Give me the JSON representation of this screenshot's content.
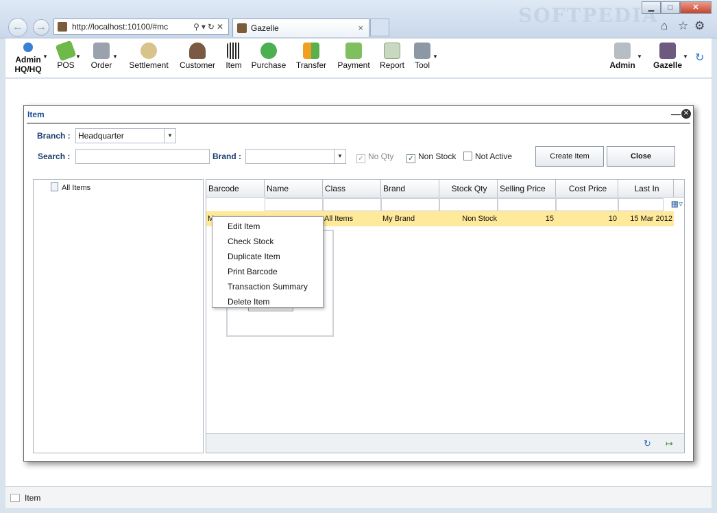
{
  "browser": {
    "address": "http://localhost:10100/#mc",
    "tab_title": "Gazelle",
    "tab_close": "×",
    "watermark": "SOFTPEDIA",
    "win_min": "▁",
    "win_max": "□",
    "win_close": "✕"
  },
  "toolbar": {
    "admin_user": "Admin HQ/HQ",
    "pos": "POS",
    "order": "Order",
    "settlement": "Settlement",
    "customer": "Customer",
    "item": "Item",
    "purchase": "Purchase",
    "transfer": "Transfer",
    "payment": "Payment",
    "report": "Report",
    "tool": "Tool",
    "admin": "Admin",
    "gazelle": "Gazelle"
  },
  "dialog": {
    "title": "Item",
    "branch_label": "Branch :",
    "branch_value": "Headquarter",
    "search_label": "Search :",
    "search_value": "",
    "brand_label": "Brand :",
    "brand_value": "",
    "no_qty": "No Qty",
    "non_stock": "Non Stock",
    "not_active": "Not Active",
    "create_item": "Create Item",
    "close": "Close"
  },
  "tree": {
    "root": "All Items"
  },
  "grid": {
    "columns": [
      "Barcode",
      "Name",
      "Class",
      "Brand",
      "Stock Qty",
      "Selling Price",
      "Cost Price",
      "Last In"
    ],
    "row": {
      "barcode": "M",
      "name": "",
      "class": "All Items",
      "brand": "My Brand",
      "stock_qty": "Non Stock",
      "selling_price": "15",
      "cost_price": "10",
      "last_in": "15 Mar 2012"
    }
  },
  "context_menu": [
    "Edit Item",
    "Check Stock",
    "Duplicate Item",
    "Print Barcode",
    "Transaction Summary",
    "Delete Item"
  ],
  "status": {
    "text": "Item"
  },
  "colors": {
    "accent": "#1b4f9a",
    "row_highlight": "#ffe99a"
  }
}
